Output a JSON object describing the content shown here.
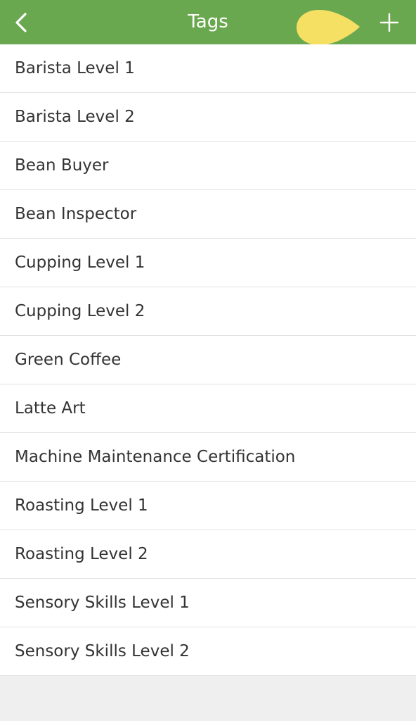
{
  "header": {
    "title": "Tags",
    "background_color": "#6aa84f",
    "back_icon": "chevron-left-icon",
    "add_icon": "plus-icon",
    "pointer_hint_color": "#f5e063"
  },
  "tags": [
    "Barista Level 1",
    "Barista Level 2",
    "Bean Buyer",
    "Bean Inspector",
    "Cupping Level 1",
    "Cupping Level 2",
    "Green Coffee",
    "Latte Art",
    "Machine Maintenance Certification",
    "Roasting Level 1",
    "Roasting Level 2",
    "Sensory Skills Level 1",
    "Sensory Skills Level 2"
  ]
}
